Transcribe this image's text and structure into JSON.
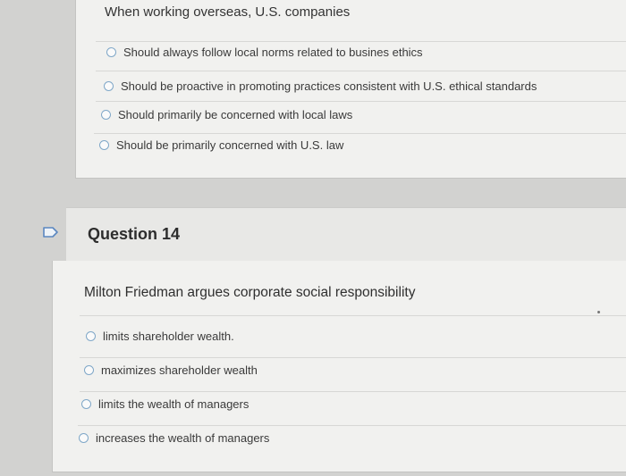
{
  "question13": {
    "stem": "When working overseas, U.S. companies",
    "options": [
      "Should always follow local norms related to busines ethics",
      "Should be proactive in promoting practices consistent with U.S. ethical standards",
      "Should primarily be concerned with local laws",
      "Should be primarily concerned with U.S. law"
    ]
  },
  "question14": {
    "title": "Question 14",
    "stem": "Milton Friedman argues corporate social responsibility",
    "options": [
      "limits shareholder wealth.",
      "maximizes shareholder wealth",
      "limits the wealth of managers",
      "increases the wealth of managers"
    ]
  },
  "colors": {
    "radio_border": "#7fa7c8",
    "flag_border": "#5b87c0"
  }
}
